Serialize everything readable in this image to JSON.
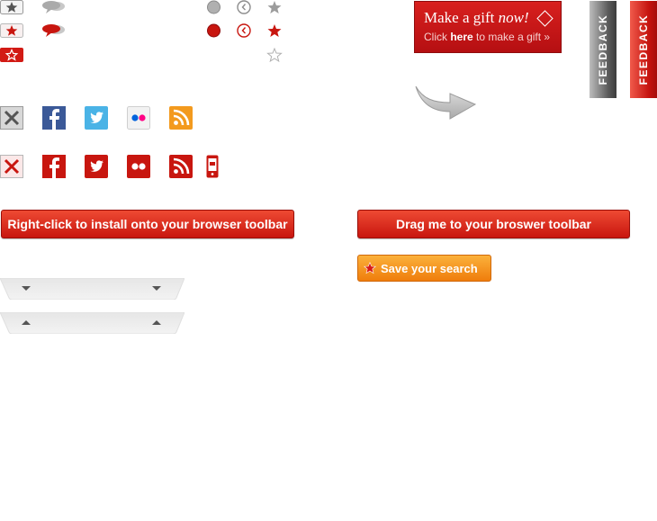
{
  "gift_banner": {
    "title_plain": "Make a gift",
    "title_italic": "now!",
    "subtitle_prefix": "Click",
    "subtitle_bold": "here",
    "subtitle_suffix": "to make a gift »"
  },
  "feedback_tabs": [
    {
      "label": "FEEDBACK",
      "color": "#555555"
    },
    {
      "label": "FEEDBACK",
      "color": "#c5130f"
    }
  ],
  "social_icons_grey": [
    "close-icon",
    "facebook-icon",
    "twitter-icon",
    "flickr-icon",
    "rss-icon"
  ],
  "social_icons_red": [
    "close-icon",
    "facebook-icon",
    "twitter-icon",
    "flickr-icon",
    "rss-icon",
    "mobile-icon"
  ],
  "buttons": {
    "install_label": "Right-click to install onto your browser toolbar",
    "drag_label": "Drag me to your broswer toolbar",
    "save_search_label": "Save your search"
  },
  "colors": {
    "accent_red": "#c8160f",
    "accent_orange": "#ef7d0c",
    "grey": "#8c8c8c",
    "twitter_blue": "#4ab3e6",
    "facebook_blue": "#3b5998"
  }
}
